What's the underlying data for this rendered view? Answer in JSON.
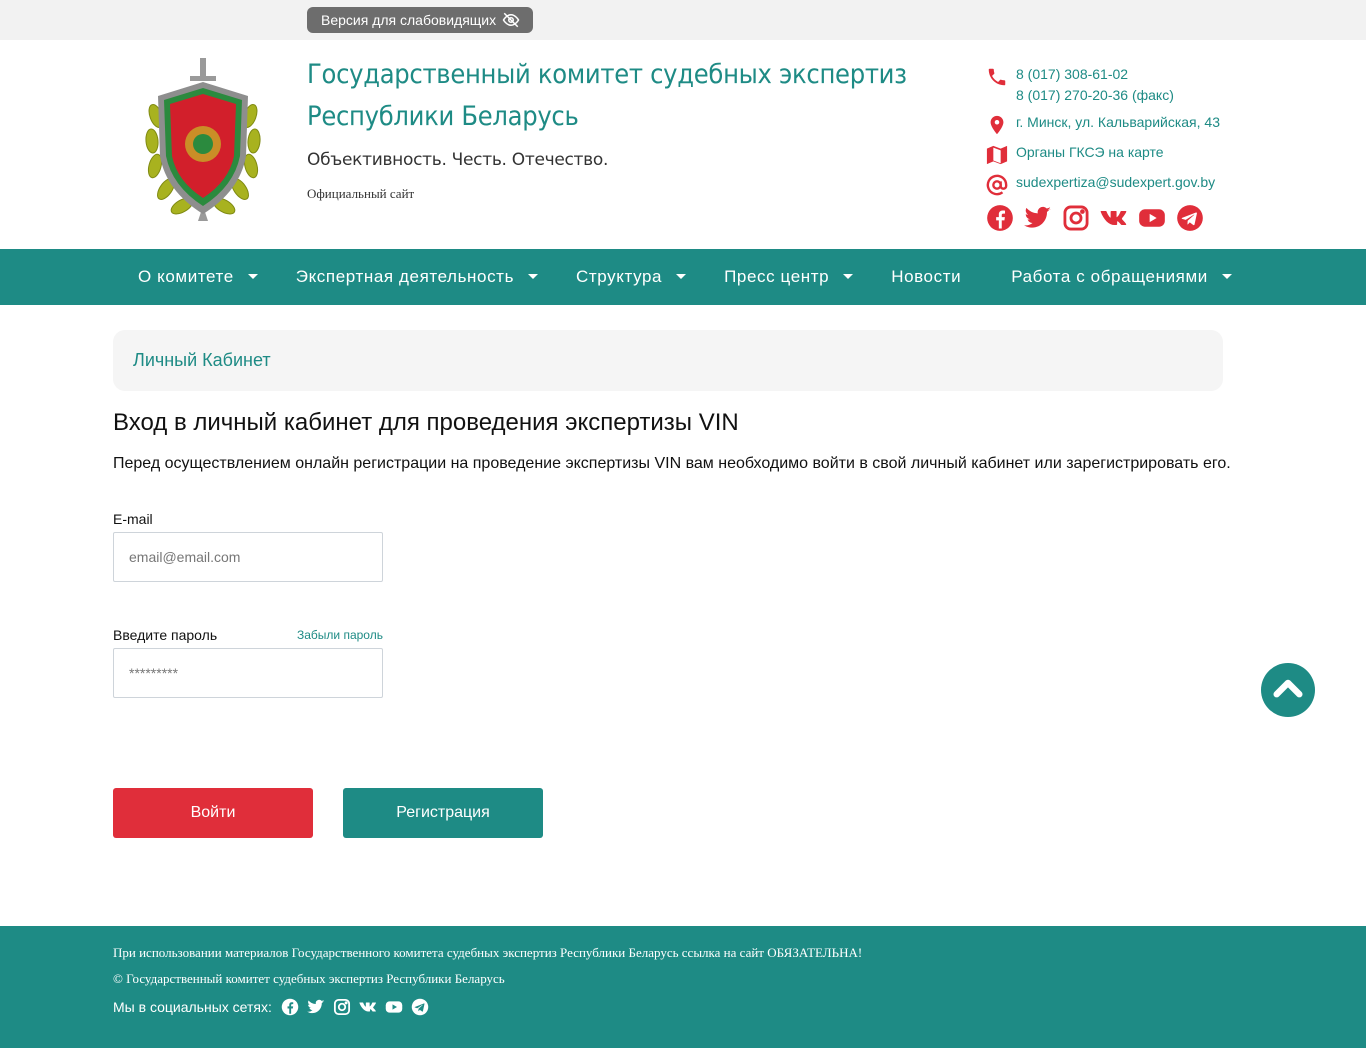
{
  "topbar": {
    "vision_label": "Версия для слабовидящих"
  },
  "header": {
    "title": "Государственный комитет судебных экспертиз Республики Беларусь",
    "motto": "Объективность. Честь. Отечество.",
    "official": "Официальный сайт"
  },
  "contacts": {
    "phone1": "8 (017) 308-61-02",
    "phone2": "8 (017) 270-20-36 (факс)",
    "address": "г. Минск, ул. Кальварийская, 43",
    "map_link": "Органы ГКСЭ на карте",
    "email": "sudexpertiza@sudexpert.gov.by"
  },
  "social_icons": [
    "facebook-icon",
    "twitter-icon",
    "instagram-icon",
    "vk-icon",
    "youtube-icon",
    "telegram-icon"
  ],
  "nav": {
    "items": [
      {
        "label": "О комитете",
        "has_submenu": true
      },
      {
        "label": "Экспертная деятельность",
        "has_submenu": true
      },
      {
        "label": "Структура",
        "has_submenu": true
      },
      {
        "label": "Пресс центр",
        "has_submenu": true
      },
      {
        "label": "Новости",
        "has_submenu": false
      },
      {
        "label": "Работа с обращениями",
        "has_submenu": true
      }
    ]
  },
  "breadcrumb": {
    "current": "Личный Кабинет"
  },
  "main": {
    "heading": "Вход в личный кабинет для проведения экспертизы VIN",
    "lead": "Перед осуществлением онлайн регистрации на проведение экспертизы VIN вам необходимо войти в свой личный кабинет или зарегистрировать его."
  },
  "form": {
    "email_label": "E-mail",
    "email_placeholder": "email@email.com",
    "password_label": "Введите пароль",
    "forgot_label": "Забыли пароль",
    "password_placeholder": "*********",
    "login_label": "Войти",
    "register_label": "Регистрация"
  },
  "footer": {
    "notice": "При использовании материалов Государственного комитета судебных экспертиз Республики Беларусь ссылка на сайт ОБЯЗАТЕЛЬНА!",
    "copyright": "© Государственный комитет судебных экспертиз Республики Беларусь",
    "social_label": "Мы в социальных сетях:"
  },
  "colors": {
    "brand": "#1e8b85",
    "accent_red": "#e02e3a",
    "icon_red": "#e02e3a"
  }
}
